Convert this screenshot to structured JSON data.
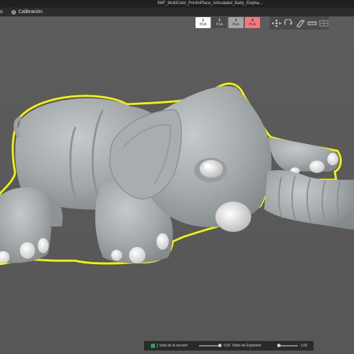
{
  "window": {
    "title": "3MF_MultiColor_PrintInPlace_Articulated_Baby_Elepha..."
  },
  "menu": {
    "partial_item": "o",
    "calibration_label": "Calibración"
  },
  "filaments": [
    {
      "index": "1",
      "material": "PLA",
      "color": "#ffffff",
      "text_color": "#222222"
    },
    {
      "index": "2",
      "material": "PLA",
      "color": "#4a4a4a",
      "text_color": "#dddddd"
    },
    {
      "index": "3",
      "material": "PLA",
      "color": "#a6a6a6",
      "text_color": "#222222"
    },
    {
      "index": "4",
      "material": "PLA",
      "color": "#f07d7d",
      "text_color": "#222222"
    }
  ],
  "toolbar": {
    "tools": [
      "move-icon",
      "rotate-icon",
      "paint-icon",
      "measure-icon",
      "grid-icon"
    ]
  },
  "bottom": {
    "section_view_label": "Vista de la sección",
    "section_view_value": "0,00",
    "explosion_ratio_label": "Ratio de Explosión",
    "explosion_ratio_value": "1,00"
  },
  "colors": {
    "selection_outline": "#f2f20f",
    "model": "#a9aeb0",
    "background": "#5b5b5b"
  }
}
